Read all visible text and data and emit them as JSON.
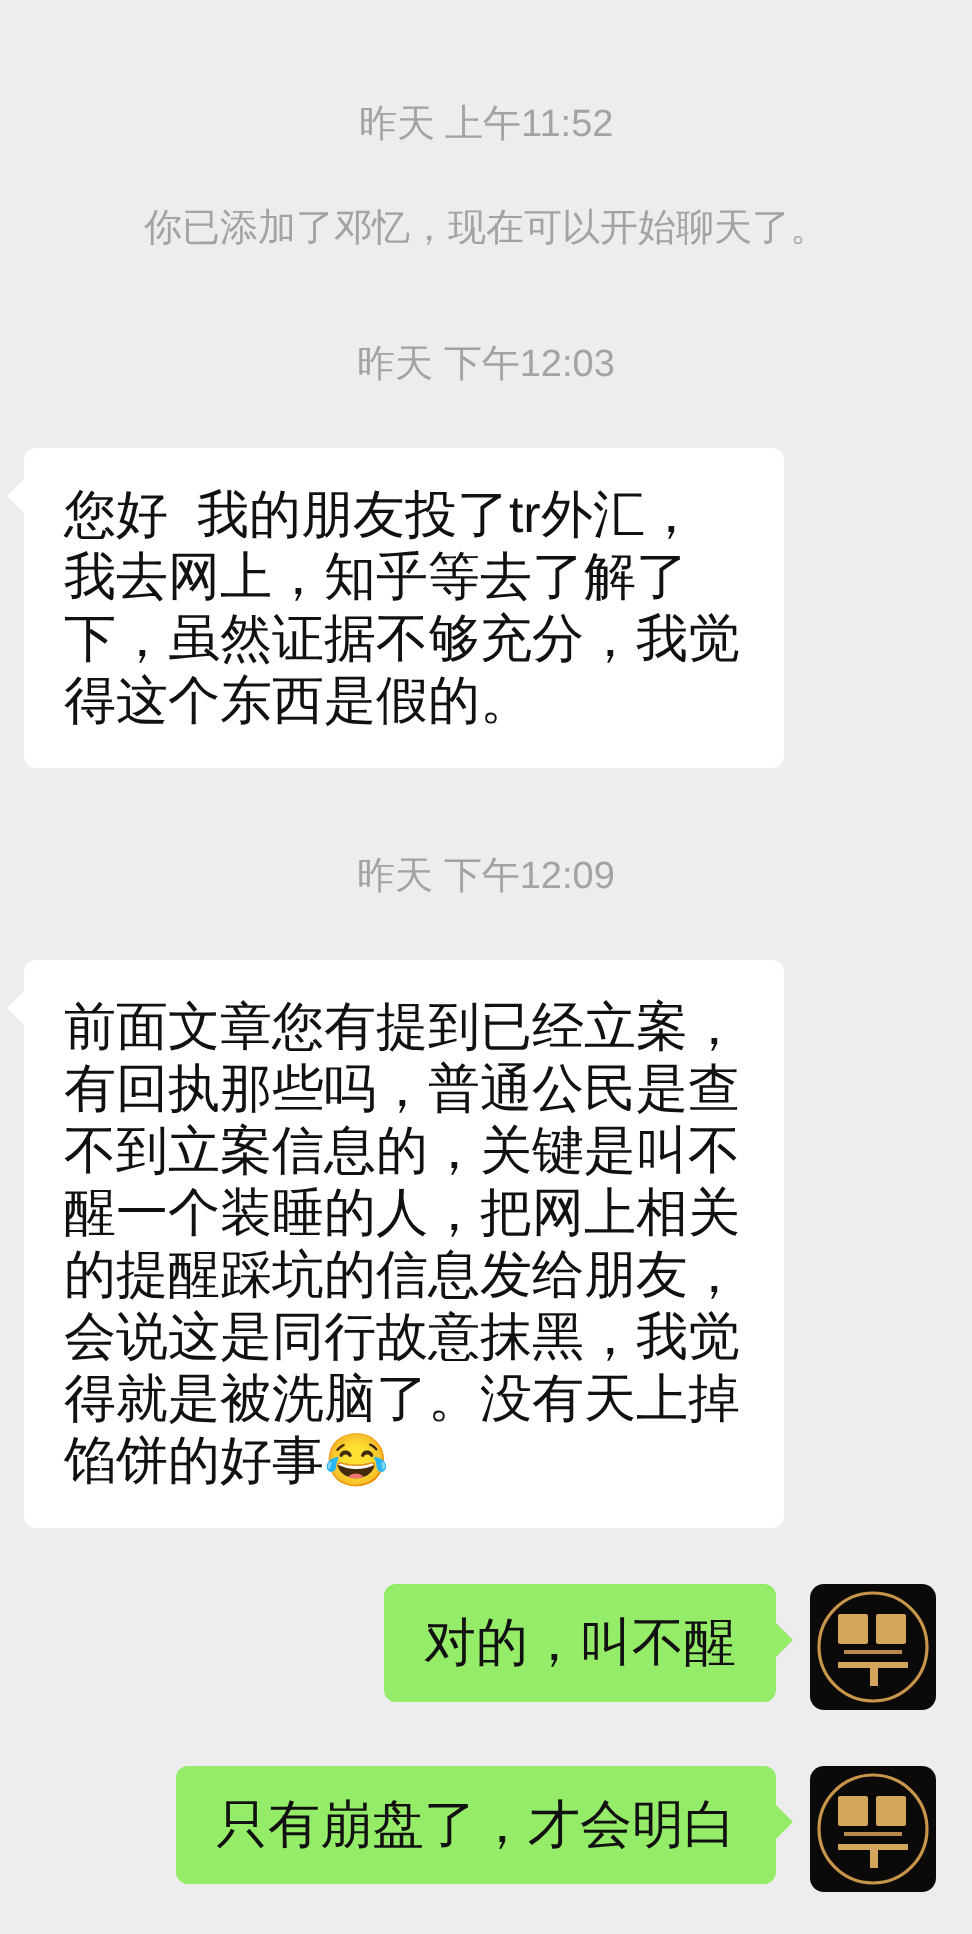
{
  "messages": [
    {
      "kind": "time",
      "text": "昨天 上午11:52"
    },
    {
      "kind": "system",
      "text": "你已添加了邓忆，现在可以开始聊天了。"
    },
    {
      "kind": "time",
      "text": "昨天 下午12:03"
    },
    {
      "kind": "incoming",
      "text": "您好  我的朋友投了tr外汇，我去网上，知乎等去了解了下，虽然证据不够充分，我觉得这个东西是假的。"
    },
    {
      "kind": "time",
      "text": "昨天 下午12:09"
    },
    {
      "kind": "incoming",
      "text": "前面文章您有提到已经立案，有回执那些吗，普通公民是查不到立案信息的，关键是叫不醒一个装睡的人，把网上相关的提醒踩坑的信息发给朋友，会说这是同行故意抹黑，我觉得就是被洗脑了。没有天上掉馅饼的好事😂"
    },
    {
      "kind": "outgoing",
      "text": "对的，叫不醒"
    },
    {
      "kind": "outgoing",
      "text": "只有崩盘了，才会明白"
    }
  ]
}
